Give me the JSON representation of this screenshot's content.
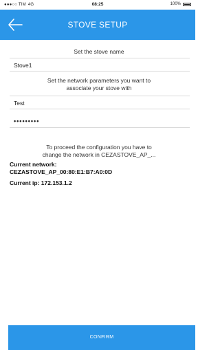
{
  "status_bar": {
    "carrier": "●●●○○ TIM",
    "network": "4G",
    "time": "08:25",
    "battery": "100%"
  },
  "header": {
    "back_icon": "arrow-left-icon",
    "title": "STOVE SETUP",
    "background": "#2b96e8"
  },
  "stove_name": {
    "label": "Set the stove name",
    "value": "Stove1"
  },
  "network": {
    "label_line1": "Set the network parameters you want to",
    "label_line2": "associate your stove with",
    "ssid": "Test",
    "password_mask": "•••••••••"
  },
  "instructions": {
    "line1": "To proceed the configuration you have to",
    "line2": "change the network in CEZASTOVE_AP_..."
  },
  "current": {
    "network_label": "Current network:",
    "network_value": "CEZASTOVE_AP_00:80:E1:B7:A0:0D",
    "ip_text": "Current ip: 172.153.1.2"
  },
  "confirm": {
    "label": "CONFIRM"
  }
}
